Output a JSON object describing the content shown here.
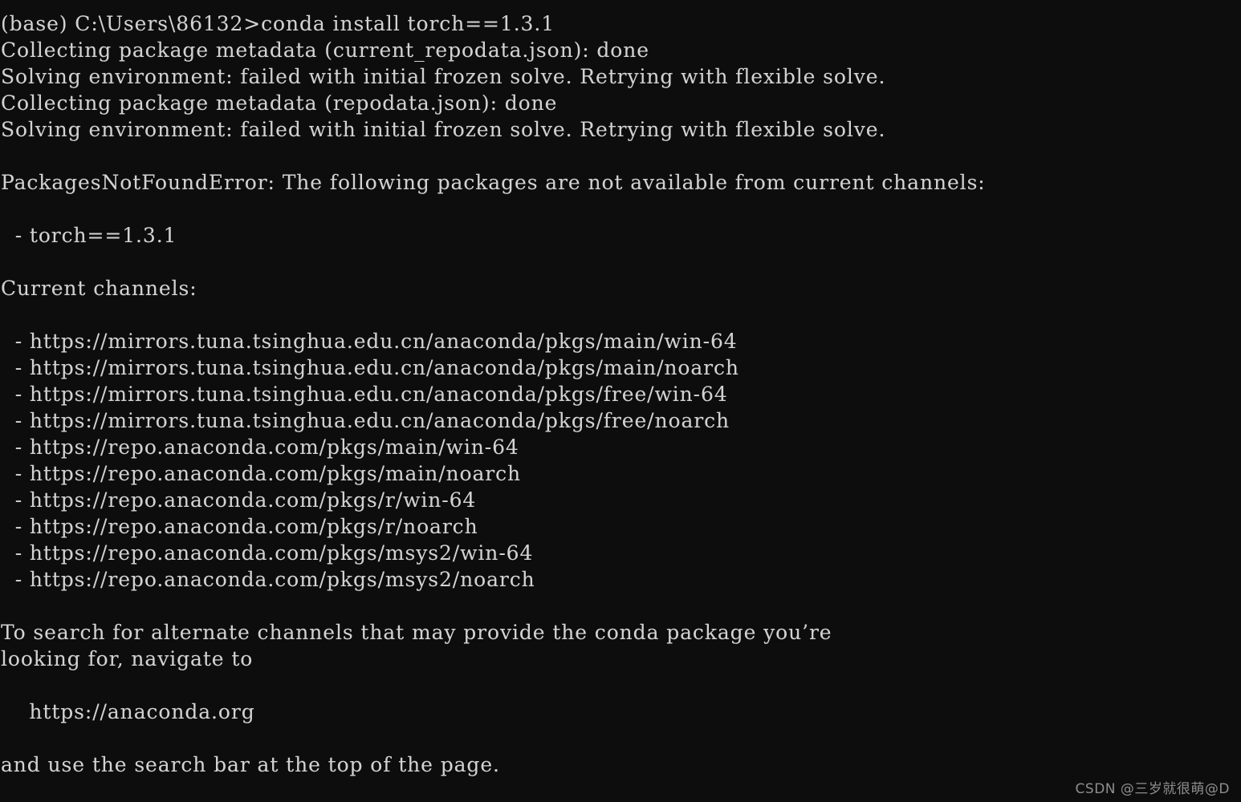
{
  "terminal": {
    "background_color": "#0d0d0d",
    "text_color": "#d2d2d2",
    "prompt_prefix": "(base) C:\\Users\\86132>",
    "command": "conda install torch==1.3.1",
    "lines": [
      "(base) C:\\Users\\86132>conda install torch==1.3.1",
      "Collecting package metadata (current_repodata.json): done",
      "Solving environment: failed with initial frozen solve. Retrying with flexible solve.",
      "Collecting package metadata (repodata.json): done",
      "Solving environment: failed with initial frozen solve. Retrying with flexible solve.",
      "",
      "PackagesNotFoundError: The following packages are not available from current channels:",
      "",
      "  - torch==1.3.1",
      "",
      "Current channels:",
      "",
      "  - https://mirrors.tuna.tsinghua.edu.cn/anaconda/pkgs/main/win-64",
      "  - https://mirrors.tuna.tsinghua.edu.cn/anaconda/pkgs/main/noarch",
      "  - https://mirrors.tuna.tsinghua.edu.cn/anaconda/pkgs/free/win-64",
      "  - https://mirrors.tuna.tsinghua.edu.cn/anaconda/pkgs/free/noarch",
      "  - https://repo.anaconda.com/pkgs/main/win-64",
      "  - https://repo.anaconda.com/pkgs/main/noarch",
      "  - https://repo.anaconda.com/pkgs/r/win-64",
      "  - https://repo.anaconda.com/pkgs/r/noarch",
      "  - https://repo.anaconda.com/pkgs/msys2/win-64",
      "  - https://repo.anaconda.com/pkgs/msys2/noarch",
      "",
      "To search for alternate channels that may provide the conda package you’re",
      "looking for, navigate to",
      "",
      "    https://anaconda.org",
      "",
      "and use the search bar at the top of the page."
    ],
    "error_name": "PackagesNotFoundError",
    "missing_package": "torch==1.3.1",
    "channels": [
      "https://mirrors.tuna.tsinghua.edu.cn/anaconda/pkgs/main/win-64",
      "https://mirrors.tuna.tsinghua.edu.cn/anaconda/pkgs/main/noarch",
      "https://mirrors.tuna.tsinghua.edu.cn/anaconda/pkgs/free/win-64",
      "https://mirrors.tuna.tsinghua.edu.cn/anaconda/pkgs/free/noarch",
      "https://repo.anaconda.com/pkgs/main/win-64",
      "https://repo.anaconda.com/pkgs/main/noarch",
      "https://repo.anaconda.com/pkgs/r/win-64",
      "https://repo.anaconda.com/pkgs/r/noarch",
      "https://repo.anaconda.com/pkgs/msys2/win-64",
      "https://repo.anaconda.com/pkgs/msys2/noarch"
    ],
    "anaconda_url": "https://anaconda.org"
  },
  "watermark": {
    "text": "CSDN @三岁就很萌@D",
    "color": "#9a9a9a"
  }
}
